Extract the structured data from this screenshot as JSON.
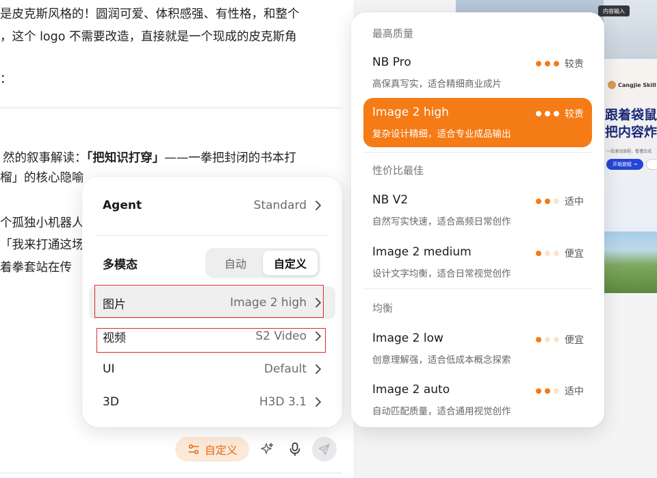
{
  "chat": {
    "lines": [
      "是皮克斯风格的！圆润可爱、体积感强、有性格，和整个",
      "，这个 logo 不需要改造，直接就是一个现成的皮克斯角",
      "：",
      "然的叙事解读：",
      "「把知识打穿」",
      "——一拳把封闭的书本打",
      "榴」的核心隐喻",
      "个孤独小机器人",
      "「我来打通这场",
      "着拳套站在传"
    ]
  },
  "composer": {
    "mode_label": "自定义",
    "mode_icon": "sliders-icon",
    "magic_icon": "sparkle-icon",
    "mic_icon": "microphone-icon",
    "send_icon": "send-icon"
  },
  "menu": {
    "agent": {
      "label": "Agent",
      "value": "Standard"
    },
    "multimodal": {
      "label": "多模态",
      "options": [
        "自动",
        "自定义"
      ],
      "selected": "自定义"
    },
    "rows": [
      {
        "label": "图片",
        "value": "Image 2 high"
      },
      {
        "label": "视频",
        "value": "S2 Video"
      },
      {
        "label": "UI",
        "value": "Default"
      },
      {
        "label": "3D",
        "value": "H3D 3.1"
      }
    ]
  },
  "preview": {
    "badge": "内容输入",
    "brand": "Cangjie Skill",
    "headline_1": "跟着袋鼠",
    "headline_2": "把内容炸",
    "sub": "一段滚动旅程，看懂合成",
    "cta": "开始旅程 →"
  },
  "picker": {
    "sections": [
      "最高质量",
      "性价比最佳",
      "均衡"
    ],
    "options": [
      {
        "name": "NB Pro",
        "desc": "高保真写实，适合精细商业成片",
        "cost": "较贵",
        "level": 3,
        "selected": false
      },
      {
        "name": "Image 2 high",
        "desc": "复杂设计精细，适合专业成品输出",
        "cost": "较贵",
        "level": 3,
        "selected": true
      },
      {
        "name": "NB V2",
        "desc": "自然写实快速，适合高频日常创作",
        "cost": "适中",
        "level": 2,
        "selected": false
      },
      {
        "name": "Image 2 medium",
        "desc": "设计文字均衡，适合日常视觉创作",
        "cost": "便宜",
        "level": 1,
        "selected": false
      },
      {
        "name": "Image 2 low",
        "desc": "创意理解强，适合低成本概念探索",
        "cost": "便宜",
        "level": 1,
        "selected": false
      },
      {
        "name": "Image 2 auto",
        "desc": "自动匹配质量，适合通用视觉创作",
        "cost": "适中",
        "level": 2,
        "selected": false
      }
    ]
  },
  "colors": {
    "accent": "#f47b16",
    "dot_on": "#f47b16",
    "dot_off": "#fbe3cf",
    "dot_on_selected": "#ffffff",
    "dot_off_selected": "#ffffff"
  }
}
